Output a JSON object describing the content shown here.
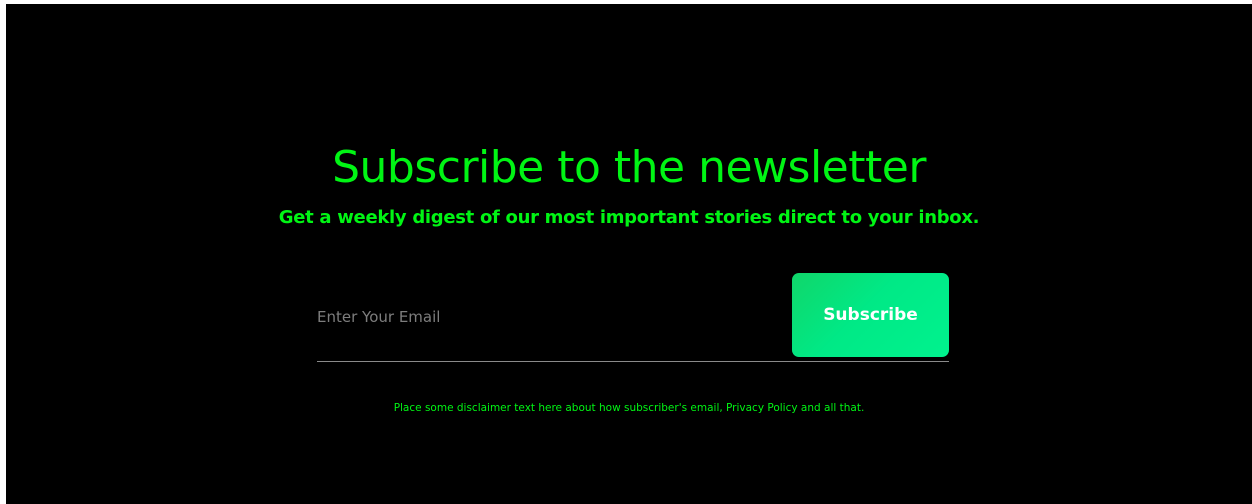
{
  "newsletter": {
    "title": "Subscribe to the newsletter",
    "subtitle": "Get a weekly digest of our most important stories direct to your inbox.",
    "email_placeholder": "Enter Your Email",
    "email_value": "",
    "subscribe_label": "Subscribe",
    "disclaimer": "Place some disclaimer text here about how subscriber's email, Privacy Policy and all that."
  },
  "colors": {
    "background": "#000000",
    "accent_text": "#00f514",
    "button_gradient_start": "#10d66a",
    "button_gradient_end": "#00f28e",
    "button_text": "#ffffff",
    "input_underline": "#8a8a8a",
    "placeholder": "#7d7d7d"
  }
}
